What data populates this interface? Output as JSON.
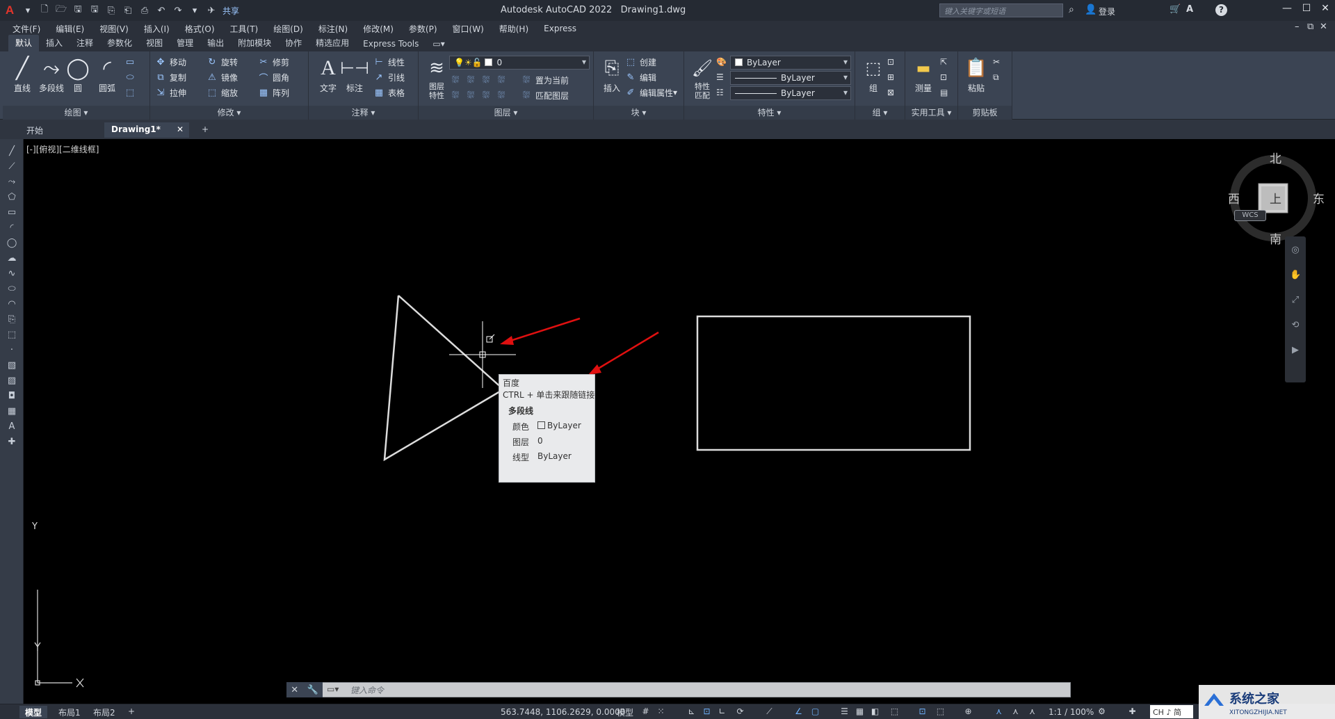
{
  "window": {
    "title": "Autodesk AutoCAD 2022",
    "file": "Drawing1.dwg",
    "share_label": "共享",
    "search_placeholder": "键入关键字或短语",
    "login_label": "登录",
    "help": "?"
  },
  "menu": [
    "文件(F)",
    "编辑(E)",
    "视图(V)",
    "插入(I)",
    "格式(O)",
    "工具(T)",
    "绘图(D)",
    "标注(N)",
    "修改(M)",
    "参数(P)",
    "窗口(W)",
    "帮助(H)",
    "Express"
  ],
  "ribbon_tabs": [
    "默认",
    "插入",
    "注释",
    "参数化",
    "视图",
    "管理",
    "输出",
    "附加模块",
    "协作",
    "精选应用",
    "Express Tools"
  ],
  "ribbon": {
    "draw": {
      "title": "绘图",
      "tools": [
        "直线",
        "多段线",
        "圆",
        "圆弧"
      ]
    },
    "modify": {
      "title": "修改",
      "tools": [
        "移动",
        "旋转",
        "修剪",
        "复制",
        "镜像",
        "圆角",
        "拉伸",
        "缩放",
        "阵列"
      ]
    },
    "annotation": {
      "title": "注释",
      "tools": [
        "文字",
        "标注",
        "线性",
        "引线",
        "表格"
      ]
    },
    "layers": {
      "title": "图层",
      "big_tool": "图层特性",
      "current_layer": "0",
      "tools": [
        "置为当前",
        "匹配图层"
      ]
    },
    "block": {
      "title": "块",
      "big_tool": "插入",
      "tools": [
        "创建",
        "编辑",
        "编辑属性"
      ]
    },
    "properties": {
      "title": "特性",
      "big_tool": "特性匹配",
      "color": "ByLayer",
      "linetype": "ByLayer",
      "lineweight": "ByLayer"
    },
    "groups": {
      "title": "组",
      "big_tool": "组"
    },
    "utilities": {
      "title": "实用工具",
      "big_tool": "测量"
    },
    "clipboard": {
      "title": "剪贴板",
      "big_tool": "粘贴"
    }
  },
  "file_tabs": {
    "start": "开始",
    "active": "Drawing1*",
    "close": "✕",
    "add": "+"
  },
  "viewport": {
    "label": "[-][俯视][二维线框]"
  },
  "viewcube": {
    "north": "北",
    "south": "南",
    "east": "东",
    "west": "西",
    "top": "上",
    "wcs": "WCS"
  },
  "ucs": {
    "x": "X",
    "y": "Y"
  },
  "tooltip": {
    "link": "百度",
    "hint": "CTRL + 单击来跟随链接",
    "title": "多段线",
    "props": [
      {
        "key": "颜色",
        "value": "ByLayer"
      },
      {
        "key": "图层",
        "value": "0"
      },
      {
        "key": "线型",
        "value": "ByLayer"
      }
    ]
  },
  "command": {
    "placeholder": "键入命令"
  },
  "status": {
    "tabs": [
      "模型",
      "布局1",
      "布局2"
    ],
    "add_tab": "+",
    "coordinates": "563.7448, 1106.2629, 0.0000",
    "model": "模型",
    "scale": "1:1 / 100%",
    "ime": "CH ♪ 简"
  },
  "watermark": {
    "text": "系统之家",
    "url": "XITONGZHIJIA.NET"
  },
  "colors": {
    "accent": "#6fb3ff",
    "arrow": "#e01010",
    "background": "#000000",
    "ribbon": "#3b4453"
  }
}
